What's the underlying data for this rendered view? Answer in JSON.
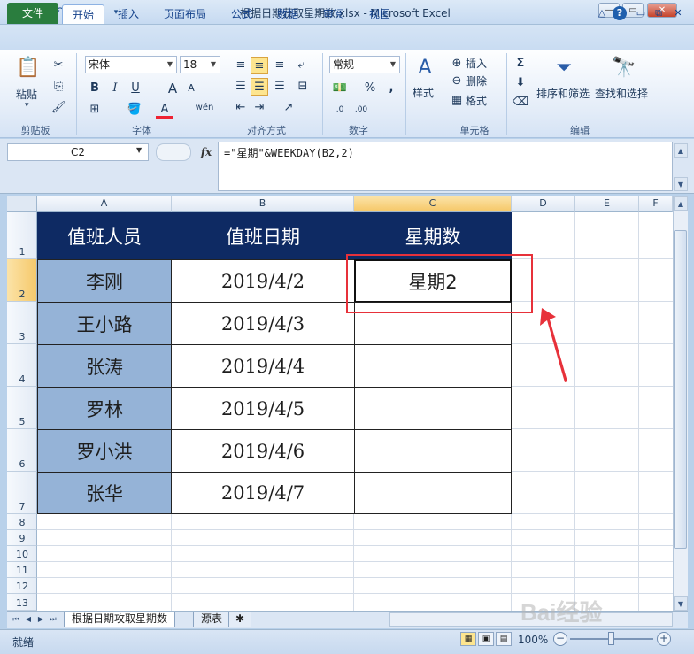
{
  "window": {
    "title": "根据日期获取星期数.xlsx - Microsoft Excel",
    "app_icon": "excel-icon"
  },
  "ribbon_tabs": [
    "文件",
    "开始",
    "插入",
    "页面布局",
    "公式",
    "数据",
    "审阅",
    "视图"
  ],
  "ribbon": {
    "clipboard": {
      "paste_label": "粘贴",
      "group_label": "剪贴板"
    },
    "font": {
      "name": "宋体",
      "size": "18",
      "group_label": "字体",
      "bold": "B",
      "italic": "I",
      "underline": "U",
      "font_color_letter": "A",
      "phonetic": "wén"
    },
    "alignment": {
      "group_label": "对齐方式"
    },
    "number": {
      "format": "常规",
      "percent": "%",
      "comma": ",",
      "inc_decimal": "←.0\n.00",
      "group_label": "数字"
    },
    "styles": {
      "label": "样式"
    },
    "cells": {
      "insert": "插入",
      "delete": "删除",
      "format": "格式",
      "group_label": "单元格"
    },
    "editing": {
      "sigma": "Σ",
      "sort_filter": "排序和筛选",
      "find_select": "查找和选择",
      "group_label": "编辑"
    }
  },
  "formula_bar": {
    "name_box": "C2",
    "fx": "fx",
    "formula": "=\"星期\"&WEEKDAY(B2,2)"
  },
  "columns": [
    "A",
    "B",
    "C",
    "D",
    "E",
    "F"
  ],
  "rows": [
    "1",
    "2",
    "3",
    "4",
    "5",
    "6",
    "7",
    "8",
    "9",
    "10",
    "11",
    "12",
    "13"
  ],
  "table": {
    "headers": [
      "值班人员",
      "值班日期",
      "星期数"
    ],
    "rows": [
      [
        "李刚",
        "2019/4/2",
        "星期2"
      ],
      [
        "王小路",
        "2019/4/3",
        ""
      ],
      [
        "张涛",
        "2019/4/4",
        ""
      ],
      [
        "罗林",
        "2019/4/5",
        ""
      ],
      [
        "罗小洪",
        "2019/4/6",
        ""
      ],
      [
        "张华",
        "2019/4/7",
        ""
      ]
    ]
  },
  "sheets": [
    "根据日期攻取星期数",
    "源表"
  ],
  "status": {
    "ready": "就绪",
    "zoom": "100%"
  },
  "watermark": "Bai经验",
  "colors": {
    "header_fill": "#0e2a63",
    "name_fill": "#95b3d7",
    "highlight": "#e7313a",
    "file_tab": "#2a7d3e"
  }
}
